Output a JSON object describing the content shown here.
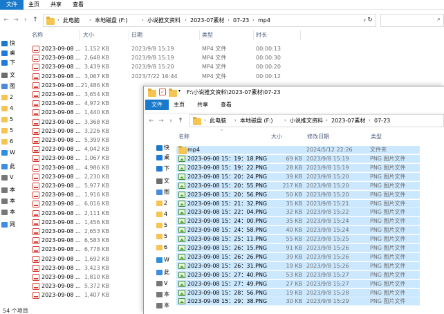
{
  "back_window": {
    "ribbon_tabs": [
      "文件",
      "主页",
      "共享",
      "查看"
    ],
    "breadcrumb": [
      "此电脑",
      "本地磁盘 (F:)",
      "小说推文资料",
      "2023-07素材",
      "07-23",
      "mp4"
    ],
    "columns": {
      "name": "名称",
      "size": "大小",
      "date": "日期",
      "type": "类型",
      "length": "时长"
    },
    "nav_items": [
      "快",
      "桌",
      "下",
      "文",
      "图",
      "2",
      "4",
      "5",
      "5",
      "6",
      "W",
      "此",
      "V",
      "本",
      "本",
      "本",
      "网"
    ],
    "rows": [
      {
        "name": "2023-09-08 ...",
        "size": "1,152 KB",
        "date": "2023/9/8 15:19",
        "type": "MP4 文件",
        "length": "00:00:13"
      },
      {
        "name": "2023-09-08 ...",
        "size": "2,648 KB",
        "date": "2023/9/8 15:19",
        "type": "MP4 文件",
        "length": "00:00:30"
      },
      {
        "name": "2023-09-08 ...",
        "size": "3,439 KB",
        "date": "2023/9/8 15:20",
        "type": "MP4 文件",
        "length": "00:00:20"
      },
      {
        "name": "2023-09-08 ...",
        "size": "3,067 KB",
        "date": "2023/7/22 16:44",
        "type": "MP4 文件",
        "length": "00:00:12"
      },
      {
        "name": "2023-09-08 ...",
        "size": "21,486 KB",
        "date": "",
        "type": "",
        "length": ""
      },
      {
        "name": "2023-09-08 ...",
        "size": "3,654 KB",
        "date": "",
        "type": "",
        "length": ""
      },
      {
        "name": "2023-09-08 ...",
        "size": "4,972 KB",
        "date": "",
        "type": "",
        "length": ""
      },
      {
        "name": "2023-09-08 ...",
        "size": "1,440 KB",
        "date": "",
        "type": "",
        "length": ""
      },
      {
        "name": "2023-09-08 ...",
        "size": "3,368 KB",
        "date": "",
        "type": "",
        "length": ""
      },
      {
        "name": "2023-09-08 ...",
        "size": "3,226 KB",
        "date": "",
        "type": "",
        "length": ""
      },
      {
        "name": "2023-09-08 ...",
        "size": "5,399 KB",
        "date": "",
        "type": "",
        "length": ""
      },
      {
        "name": "2023-09-08 ...",
        "size": "4,042 KB",
        "date": "",
        "type": "",
        "length": ""
      },
      {
        "name": "2023-09-08 ...",
        "size": "1,067 KB",
        "date": "",
        "type": "",
        "length": ""
      },
      {
        "name": "2023-09-08 ...",
        "size": "4,986 KB",
        "date": "",
        "type": "",
        "length": ""
      },
      {
        "name": "2023-09-08 ...",
        "size": "2,230 KB",
        "date": "",
        "type": "",
        "length": ""
      },
      {
        "name": "2023-09-08 ...",
        "size": "5,977 KB",
        "date": "",
        "type": "",
        "length": ""
      },
      {
        "name": "2023-09-08 ...",
        "size": "1,916 KB",
        "date": "",
        "type": "",
        "length": ""
      },
      {
        "name": "2023-09-08 ...",
        "size": "6,016 KB",
        "date": "",
        "type": "",
        "length": ""
      },
      {
        "name": "2023-09-08 ...",
        "size": "2,111 KB",
        "date": "",
        "type": "",
        "length": ""
      },
      {
        "name": "2023-09-08 ...",
        "size": "1,456 KB",
        "date": "",
        "type": "",
        "length": ""
      },
      {
        "name": "2023-09-08 ...",
        "size": "2,653 KB",
        "date": "",
        "type": "",
        "length": ""
      },
      {
        "name": "2023-09-08 ...",
        "size": "6,583 KB",
        "date": "",
        "type": "",
        "length": ""
      },
      {
        "name": "2023-09-08 ...",
        "size": "6,778 KB",
        "date": "",
        "type": "",
        "length": ""
      },
      {
        "name": "2023-09-08 ...",
        "size": "1,692 KB",
        "date": "",
        "type": "",
        "length": ""
      },
      {
        "name": "2023-09-08 ...",
        "size": "3,423 KB",
        "date": "",
        "type": "",
        "length": ""
      },
      {
        "name": "2023-09-08 ...",
        "size": "1,810 KB",
        "date": "",
        "type": "",
        "length": ""
      },
      {
        "name": "2023-09-08 ...",
        "size": "5,372 KB",
        "date": "",
        "type": "",
        "length": ""
      },
      {
        "name": "2023-09-08 ...",
        "size": "1,407 KB",
        "date": "",
        "type": "",
        "length": ""
      }
    ],
    "status": "54 个项目"
  },
  "front_window": {
    "title": "F:\\小说推文资料\\2023-07素材\\07-23",
    "ribbon_tabs": [
      "文件",
      "主页",
      "共享",
      "查看"
    ],
    "breadcrumb": [
      "此电脑",
      "本地磁盘 (F:)",
      "小说推文资料",
      "2023-07素材",
      "07-23"
    ],
    "columns": {
      "name": "名称",
      "size": "大小",
      "date": "修改日期",
      "type": "类型"
    },
    "nav_items": [
      "快",
      "桌",
      "下",
      "文",
      "图",
      "2",
      "4",
      "5",
      "5",
      "6",
      "W",
      "此",
      "V",
      "本",
      "本",
      "本",
      "网"
    ],
    "folder_row": {
      "name": "mp4",
      "size": "",
      "date": "2024/5/12 22:26",
      "type": "文件夹"
    },
    "rows": [
      {
        "name": "2023-09-08 15：19：18.PNG",
        "size": "69 KB",
        "date": "2023/9/8 15:19",
        "type": "PNG 图片文件"
      },
      {
        "name": "2023-09-08 15：19：22.PNG",
        "size": "28 KB",
        "date": "2023/9/8 15:19",
        "type": "PNG 图片文件"
      },
      {
        "name": "2023-09-08 15：20：24.PNG",
        "size": "39 KB",
        "date": "2023/9/8 15:20",
        "type": "PNG 图片文件"
      },
      {
        "name": "2023-09-08 15：20：55.PNG",
        "size": "217 KB",
        "date": "2023/9/8 15:20",
        "type": "PNG 图片文件"
      },
      {
        "name": "2023-09-08 15：20：56.PNG",
        "size": "50 KB",
        "date": "2023/9/8 15:20",
        "type": "PNG 图片文件"
      },
      {
        "name": "2023-09-08 15：21：32.PNG",
        "size": "35 KB",
        "date": "2023/9/8 15:21",
        "type": "PNG 图片文件"
      },
      {
        "name": "2023-09-08 15：22：04.PNG",
        "size": "32 KB",
        "date": "2023/9/8 15:22",
        "type": "PNG 图片文件"
      },
      {
        "name": "2023-09-08 15：24：00.PNG",
        "size": "35 KB",
        "date": "2023/9/8 15:24",
        "type": "PNG 图片文件"
      },
      {
        "name": "2023-09-08 15：24：58.PNG",
        "size": "40 KB",
        "date": "2023/9/8 15:24",
        "type": "PNG 图片文件"
      },
      {
        "name": "2023-09-08 15：25：11.PNG",
        "size": "55 KB",
        "date": "2023/9/8 15:25",
        "type": "PNG 图片文件"
      },
      {
        "name": "2023-09-08 15：26：15.PNG",
        "size": "91 KB",
        "date": "2023/9/8 15:26",
        "type": "PNG 图片文件"
      },
      {
        "name": "2023-09-08 15：26：26.PNG",
        "size": "39 KB",
        "date": "2023/9/8 15:26",
        "type": "PNG 图片文件"
      },
      {
        "name": "2023-09-08 15：26：31.PNG",
        "size": "19 KB",
        "date": "2023/9/8 15:26",
        "type": "PNG 图片文件"
      },
      {
        "name": "2023-09-08 15：27：40.PNG",
        "size": "53 KB",
        "date": "2023/9/8 15:27",
        "type": "PNG 图片文件"
      },
      {
        "name": "2023-09-08 15：27：49.PNG",
        "size": "27 KB",
        "date": "2023/9/8 15:27",
        "type": "PNG 图片文件"
      },
      {
        "name": "2023-09-08 15：28：56.PNG",
        "size": "19 KB",
        "date": "2023/9/8 15:28",
        "type": "PNG 图片文件"
      },
      {
        "name": "2023-09-08 15：29：38.PNG",
        "size": "30 KB",
        "date": "2023/9/8 15:29",
        "type": "PNG 图片文件"
      }
    ]
  },
  "colors": {
    "file_tab": "#1979ca",
    "selection": "#cce8ff",
    "folder": "#f5c451",
    "pdf_red": "#d43a2f"
  }
}
